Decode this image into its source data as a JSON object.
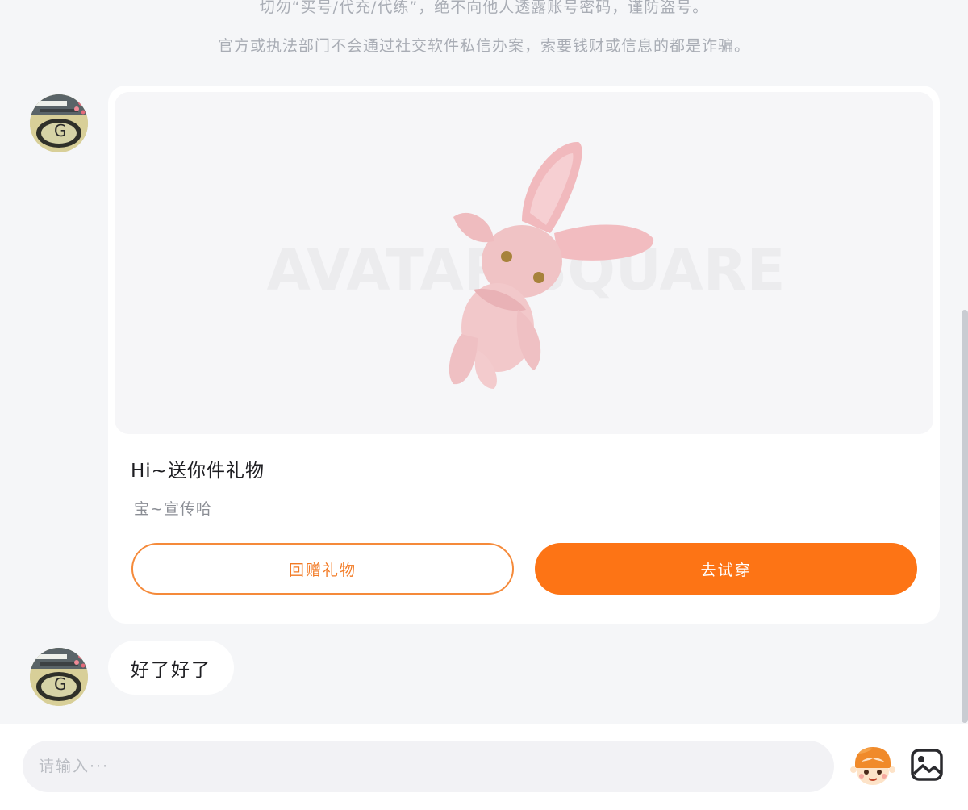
{
  "notices": {
    "line1": "切勿“买号/代充/代练”，绝不向他人透露账号密码，谨防盗号。",
    "line2": "官方或执法部门不会通过社交软件私信办案，索要钱财或信息的都是诈骗。"
  },
  "gift_card": {
    "watermark": "AVATAR SQUARE",
    "title": "Hi~送你件礼物",
    "subtitle": "宝~宣传哈",
    "return_gift_label": "回赠礼物",
    "try_on_label": "去试穿"
  },
  "message": {
    "text": "好了好了"
  },
  "composer": {
    "placeholder": "请输入···",
    "emoji_icon": "emoji-mascot-icon",
    "image_icon": "image-icon"
  },
  "colors": {
    "accent": "#fd7415",
    "outline_text": "#f27a24",
    "background": "#f5f6f8"
  }
}
